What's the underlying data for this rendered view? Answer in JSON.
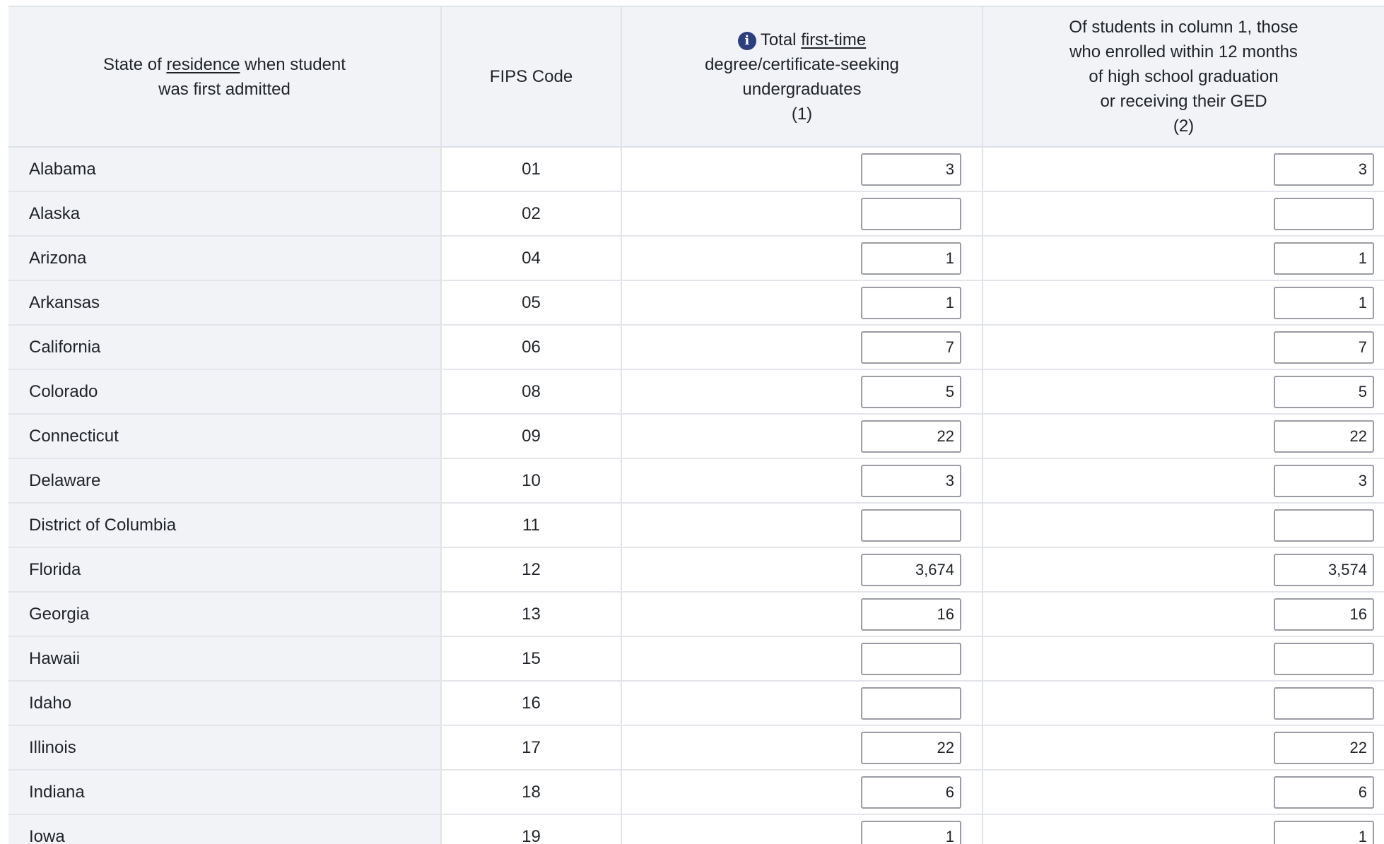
{
  "header": {
    "col_state": {
      "prefix": "State of ",
      "link": "residence",
      "line1_suffix": " when student",
      "line2": "was first admitted"
    },
    "col_fips": "FIPS Code",
    "col_one": {
      "info_icon": "info-icon",
      "prefix": "Total ",
      "link": "first-time",
      "line2": "degree/certificate-seeking",
      "line3": "undergraduates",
      "line4": "(1)"
    },
    "col_two": {
      "line1": "Of students in column 1, those",
      "line2": "who enrolled within 12 months",
      "line3": "of high school graduation",
      "line4": "or receiving their GED",
      "line5": "(2)"
    }
  },
  "rows": [
    {
      "state": "Alabama",
      "fips": "01",
      "col1": "3",
      "col2": "3"
    },
    {
      "state": "Alaska",
      "fips": "02",
      "col1": "",
      "col2": ""
    },
    {
      "state": "Arizona",
      "fips": "04",
      "col1": "1",
      "col2": "1"
    },
    {
      "state": "Arkansas",
      "fips": "05",
      "col1": "1",
      "col2": "1"
    },
    {
      "state": "California",
      "fips": "06",
      "col1": "7",
      "col2": "7"
    },
    {
      "state": "Colorado",
      "fips": "08",
      "col1": "5",
      "col2": "5"
    },
    {
      "state": "Connecticut",
      "fips": "09",
      "col1": "22",
      "col2": "22"
    },
    {
      "state": "Delaware",
      "fips": "10",
      "col1": "3",
      "col2": "3"
    },
    {
      "state": "District of Columbia",
      "fips": "11",
      "col1": "",
      "col2": ""
    },
    {
      "state": "Florida",
      "fips": "12",
      "col1": "3,674",
      "col2": "3,574"
    },
    {
      "state": "Georgia",
      "fips": "13",
      "col1": "16",
      "col2": "16"
    },
    {
      "state": "Hawaii",
      "fips": "15",
      "col1": "",
      "col2": ""
    },
    {
      "state": "Idaho",
      "fips": "16",
      "col1": "",
      "col2": ""
    },
    {
      "state": "Illinois",
      "fips": "17",
      "col1": "22",
      "col2": "22"
    },
    {
      "state": "Indiana",
      "fips": "18",
      "col1": "6",
      "col2": "6"
    },
    {
      "state": "Iowa",
      "fips": "19",
      "col1": "1",
      "col2": "1"
    }
  ],
  "colors": {
    "header_bg": "#f2f3f7",
    "icon_bg": "#2c3e7f",
    "border": "#e1e3ea"
  }
}
